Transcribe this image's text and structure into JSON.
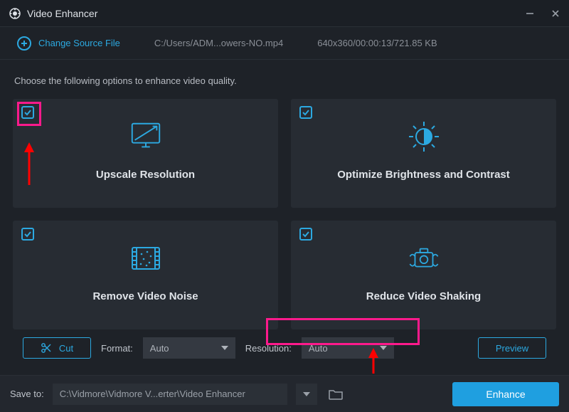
{
  "app": {
    "title": "Video Enhancer"
  },
  "source": {
    "change_label": "Change Source File",
    "path": "C:/Users/ADM...owers-NO.mp4",
    "meta": "640x360/00:00:13/721.85 KB"
  },
  "instruction": "Choose the following options to enhance video quality.",
  "cards": {
    "upscale": {
      "label": "Upscale Resolution",
      "checked": true
    },
    "brightness": {
      "label": "Optimize Brightness and Contrast",
      "checked": true
    },
    "noise": {
      "label": "Remove Video Noise",
      "checked": true
    },
    "shaking": {
      "label": "Reduce Video Shaking",
      "checked": true
    }
  },
  "controls": {
    "cut_label": "Cut",
    "format_label": "Format:",
    "format_value": "Auto",
    "resolution_label": "Resolution:",
    "resolution_value": "Auto",
    "preview_label": "Preview"
  },
  "footer": {
    "save_label": "Save to:",
    "save_path": "C:\\Vidmore\\Vidmore V...erter\\Video Enhancer",
    "enhance_label": "Enhance"
  },
  "colors": {
    "accent": "#2ca9e1",
    "highlight": "#ff1a8c",
    "arrow": "#ff0000"
  }
}
